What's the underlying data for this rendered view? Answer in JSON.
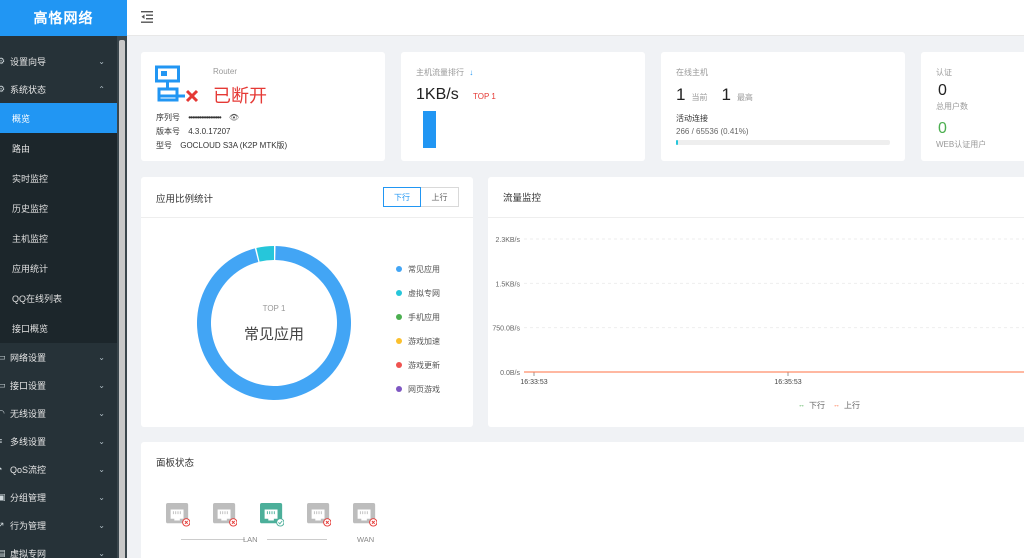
{
  "brand": "高恪网络",
  "sidebar": {
    "items": [
      {
        "label": "设置向导",
        "icon": "wizard-icon",
        "expanded": false
      },
      {
        "label": "系统状态",
        "icon": "status-icon",
        "expanded": true
      },
      {
        "label": "网络设置",
        "icon": "network-icon",
        "expanded": false
      },
      {
        "label": "接口设置",
        "icon": "interface-icon",
        "expanded": false
      },
      {
        "label": "无线设置",
        "icon": "wireless-icon",
        "expanded": false
      },
      {
        "label": "多线设置",
        "icon": "multiline-icon",
        "expanded": false
      },
      {
        "label": "QoS流控",
        "icon": "qos-icon",
        "expanded": false
      },
      {
        "label": "分组管理",
        "icon": "group-icon",
        "expanded": false
      },
      {
        "label": "行为管理",
        "icon": "behavior-icon",
        "expanded": false
      },
      {
        "label": "虚拟专网",
        "icon": "vpn-icon",
        "expanded": false
      }
    ],
    "subitems": [
      "概览",
      "路由",
      "实时监控",
      "历史监控",
      "主机监控",
      "应用统计",
      "QQ在线列表",
      "接口概览"
    ],
    "active_subitem": "概览"
  },
  "router": {
    "label": "Router",
    "status": "已断开",
    "serial_label": "序列号",
    "serial_value": "••••••••••••••••••",
    "version_label": "版本号",
    "version_value": "4.3.0.17207",
    "model_label": "型号",
    "model_value": "GOCLOUD S3A (K2P MTK版)"
  },
  "traffic_rank": {
    "title": "主机流量排行",
    "value": "1KB/s",
    "top": "TOP 1"
  },
  "online_hosts": {
    "title": "在线主机",
    "current_value": "1",
    "current_label": "当前",
    "max_value": "1",
    "max_label": "最高",
    "conn_label": "活动连接",
    "conn_value": "266 / 65536 (0.41%)",
    "conn_ratio": 0.0041
  },
  "auth": {
    "title": "认证",
    "total_value": "0",
    "total_label": "总用户数",
    "web_value": "0",
    "web_label": "WEB认证用户"
  },
  "app_ratio": {
    "title": "应用比例统计",
    "tab_down": "下行",
    "tab_up": "上行",
    "center_top": "TOP 1",
    "center_name": "常见应用",
    "legend": [
      {
        "label": "常见应用",
        "color": "#42a5f5"
      },
      {
        "label": "虚拟专网",
        "color": "#26c6da"
      },
      {
        "label": "手机应用",
        "color": "#4caf50"
      },
      {
        "label": "游戏加速",
        "color": "#fbc02d"
      },
      {
        "label": "游戏更新",
        "color": "#ef5350"
      },
      {
        "label": "网页游戏",
        "color": "#7e57c2"
      }
    ],
    "slices": [
      {
        "name": "常见应用",
        "value": 96
      },
      {
        "name": "虚拟专网",
        "value": 4
      }
    ]
  },
  "monitor": {
    "title": "流量监控",
    "legend_down": "下行",
    "legend_up": "上行",
    "down_color": "#4caf50",
    "up_color": "#ff7043"
  },
  "chart_data": {
    "type": "line",
    "x": [
      "16:33:53",
      "16:35:53"
    ],
    "series": [
      {
        "name": "下行",
        "values": [
          0,
          0
        ]
      },
      {
        "name": "上行",
        "values": [
          0,
          0
        ]
      }
    ],
    "yticks": [
      "0.0B/s",
      "750.0B/s",
      "1.5KB/s",
      "2.3KB/s"
    ],
    "grid": true,
    "legend": "bottom"
  },
  "panel": {
    "title": "面板状态",
    "lan_label": "LAN",
    "wan_label": "WAN",
    "ports": [
      {
        "name": "port-1",
        "connected": false
      },
      {
        "name": "port-2",
        "connected": false
      },
      {
        "name": "port-3",
        "connected": true
      },
      {
        "name": "port-4",
        "connected": false
      },
      {
        "name": "wan",
        "connected": false
      }
    ]
  }
}
